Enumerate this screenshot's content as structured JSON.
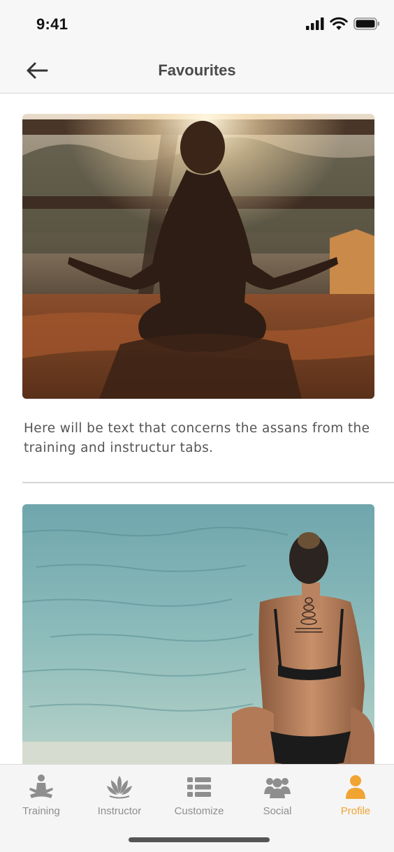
{
  "status_bar": {
    "time": "9:41"
  },
  "header": {
    "title": "Favourites"
  },
  "favourites": [
    {
      "description": "Here will be text that concerns the assans from the training and instructur tabs."
    },
    {
      "description": ""
    }
  ],
  "tabs": [
    {
      "label": "Training",
      "icon": "meditation-icon"
    },
    {
      "label": "Instructor",
      "icon": "lotus-icon"
    },
    {
      "label": "Customize",
      "icon": "list-icon"
    },
    {
      "label": "Social",
      "icon": "group-icon"
    },
    {
      "label": "Profile",
      "icon": "user-icon",
      "active": true
    }
  ],
  "colors": {
    "accent": "#f0a431",
    "inactive": "#8e8e8e",
    "bar_bg": "#f7f7f7"
  }
}
